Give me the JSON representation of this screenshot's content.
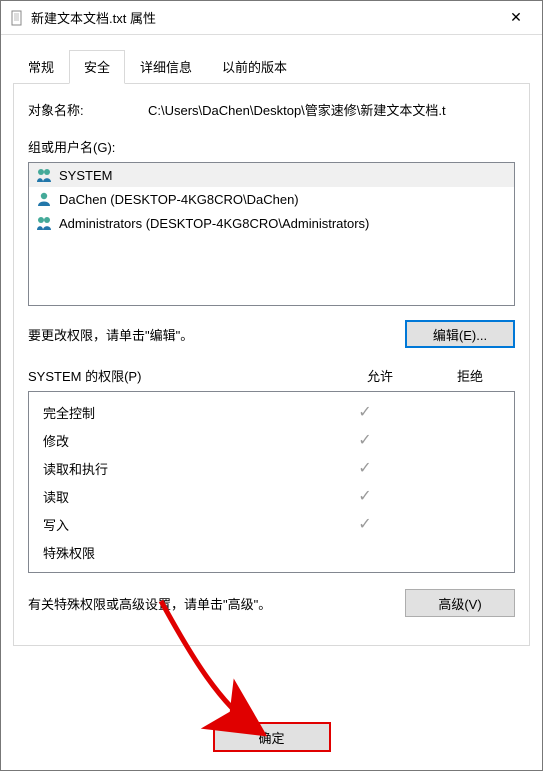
{
  "window": {
    "title": "新建文本文档.txt 属性",
    "close_glyph": "✕"
  },
  "tabs": {
    "general": "常规",
    "security": "安全",
    "details": "详细信息",
    "previous": "以前的版本"
  },
  "object": {
    "label": "对象名称:",
    "path": "C:\\Users\\DaChen\\Desktop\\管家速修\\新建文本文档.t"
  },
  "groups": {
    "label": "组或用户名(G):",
    "items": [
      {
        "name": "SYSTEM",
        "icon": "group",
        "selected": true
      },
      {
        "name": "DaChen (DESKTOP-4KG8CRO\\DaChen)",
        "icon": "user",
        "selected": false
      },
      {
        "name": "Administrators (DESKTOP-4KG8CRO\\Administrators)",
        "icon": "group",
        "selected": false
      }
    ]
  },
  "edit": {
    "hint": "要更改权限，请单击\"编辑\"。",
    "button": "编辑(E)..."
  },
  "permissions": {
    "header_name": "SYSTEM 的权限(P)",
    "header_allow": "允许",
    "header_deny": "拒绝",
    "rows": [
      {
        "name": "完全控制",
        "allow": true,
        "deny": false
      },
      {
        "name": "修改",
        "allow": true,
        "deny": false
      },
      {
        "name": "读取和执行",
        "allow": true,
        "deny": false
      },
      {
        "name": "读取",
        "allow": true,
        "deny": false
      },
      {
        "name": "写入",
        "allow": true,
        "deny": false
      },
      {
        "name": "特殊权限",
        "allow": false,
        "deny": false
      }
    ]
  },
  "advanced": {
    "hint": "有关特殊权限或高级设置，请单击\"高级\"。",
    "button": "高级(V)"
  },
  "footer": {
    "ok": "确定"
  }
}
